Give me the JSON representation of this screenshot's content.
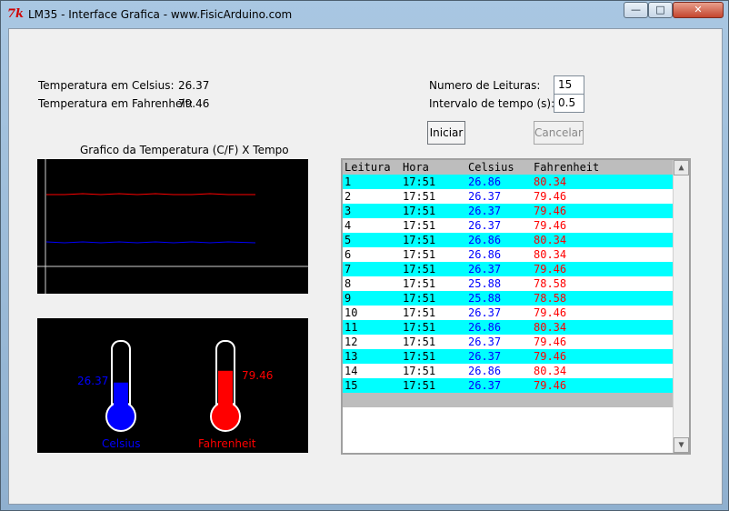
{
  "window": {
    "title": "LM35 - Interface Grafica - www.FisicArduino.com",
    "icon": "tk-icon"
  },
  "controls": {
    "min": "—",
    "max": "□",
    "close": "✕"
  },
  "readings": {
    "celsius_label": "Temperatura em Celsius:",
    "celsius_value": "26.37",
    "fahrenheit_label": "Temperatura em Fahrenheit:",
    "fahrenheit_value": "79.46"
  },
  "settings": {
    "count_label": "Numero de Leituras:",
    "count_value": "15",
    "interval_label": "Intervalo de tempo (s):",
    "interval_value": "0.5"
  },
  "buttons": {
    "start": "Iniciar",
    "cancel": "Cancelar"
  },
  "graph": {
    "title": "Grafico da Temperatura (C/F) X Tempo"
  },
  "thermometers": {
    "celsius": {
      "label": "Celsius",
      "value": "26.37",
      "level": 0.46,
      "color": "#0000ff"
    },
    "fahrenheit": {
      "label": "Fahrenheit",
      "value": "79.46",
      "level": 0.62,
      "color": "#ff0000"
    }
  },
  "table": {
    "headers": [
      "Leitura",
      "Hora",
      "Celsius",
      "Fahrenheit"
    ],
    "rows": [
      [
        "1",
        "17:51",
        "26.86",
        "80.34"
      ],
      [
        "2",
        "17:51",
        "26.37",
        "79.46"
      ],
      [
        "3",
        "17:51",
        "26.37",
        "79.46"
      ],
      [
        "4",
        "17:51",
        "26.37",
        "79.46"
      ],
      [
        "5",
        "17:51",
        "26.86",
        "80.34"
      ],
      [
        "6",
        "17:51",
        "26.86",
        "80.34"
      ],
      [
        "7",
        "17:51",
        "26.37",
        "79.46"
      ],
      [
        "8",
        "17:51",
        "25.88",
        "78.58"
      ],
      [
        "9",
        "17:51",
        "25.88",
        "78.58"
      ],
      [
        "10",
        "17:51",
        "26.37",
        "79.46"
      ],
      [
        "11",
        "17:51",
        "26.86",
        "80.34"
      ],
      [
        "12",
        "17:51",
        "26.37",
        "79.46"
      ],
      [
        "13",
        "17:51",
        "26.37",
        "79.46"
      ],
      [
        "14",
        "17:51",
        "26.86",
        "80.34"
      ],
      [
        "15",
        "17:51",
        "26.37",
        "79.46"
      ]
    ]
  },
  "colors": {
    "celsius": "#0000ff",
    "fahrenheit": "#ff0000",
    "row_alt": "#00ffff",
    "canvas": "#000000"
  }
}
